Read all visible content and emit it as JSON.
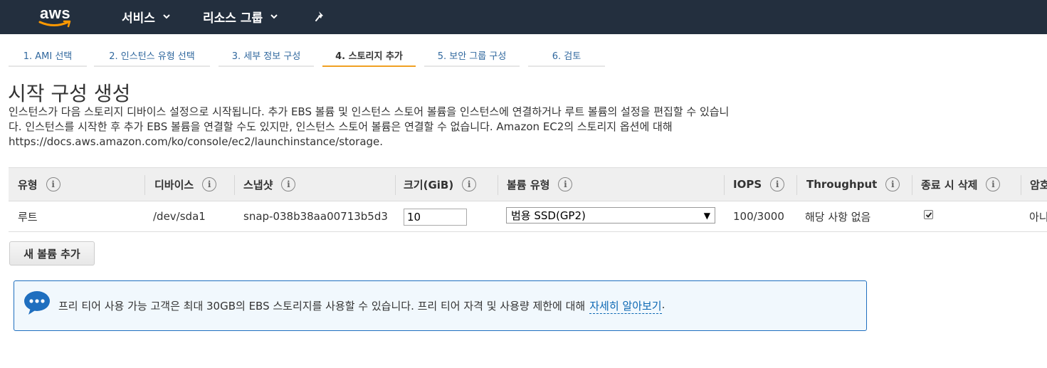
{
  "topnav": {
    "logo_text": "aws",
    "services_label": "서비스",
    "resource_groups_label": "리소스 그룹"
  },
  "steps": [
    {
      "label": "1. AMI 선택",
      "active": false
    },
    {
      "label": "2. 인스턴스 유형 선택",
      "active": false
    },
    {
      "label": "3. 세부 정보 구성",
      "active": false
    },
    {
      "label": "4. 스토리지 추가",
      "active": true
    },
    {
      "label": "5. 보안 그룹 구성",
      "active": false
    },
    {
      "label": "6. 검토",
      "active": false
    }
  ],
  "page": {
    "title": "시작 구성 생성",
    "description_lines": [
      "인스턴스가 다음 스토리지 디바이스 설정으로 시작됩니다. 추가 EBS 볼륨 및 인스턴스 스토어 볼륨을 인스턴스에 연결하거나 루트 볼륨의 설정을 편집할 수 있습니",
      "다. 인스턴스를 시작한 후 추가 EBS 볼륨을 연결할 수도 있지만, 인스턴스 스토어 볼륨은 연결할 수 없습니다. Amazon EC2의 스토리지 옵션에 대해",
      "https://docs.aws.amazon.com/ko/console/ec2/launchinstance/storage."
    ]
  },
  "table": {
    "columns": {
      "type": "유형",
      "device": "디바이스",
      "snapshot": "스냅샷",
      "size": "크기(GiB)",
      "volume_type": "볼륨 유형",
      "iops": "IOPS",
      "throughput": "Throughput",
      "delete_on_termination": "종료 시 삭제",
      "encryption": "암호"
    },
    "info_symbol": "i",
    "rows": [
      {
        "type": "루트",
        "device": "/dev/sda1",
        "snapshot": "snap-038b38aa00713b5d3",
        "size": "10",
        "volume_type": "범용 SSD(GP2)",
        "iops": "100/3000",
        "throughput": "해당 사항 없음",
        "delete_on_termination": true,
        "encryption": "아니"
      }
    ]
  },
  "add_volume_button": "새 볼륨 추가",
  "alert": {
    "text": "프리 티어 사용 가능 고객은 최대 30GB의 EBS 스토리지를 사용할 수 있습니다. 프리 티어 자격 및 사용량 제한에 대해",
    "link_text": "자세히 알아보기",
    "trailing": "."
  },
  "colors": {
    "nav_bg": "#232f3e",
    "link": "#31689e",
    "active_tab": "#f0a023",
    "alert_border": "#1f6fbf",
    "alert_bg": "#f1f8fd"
  }
}
